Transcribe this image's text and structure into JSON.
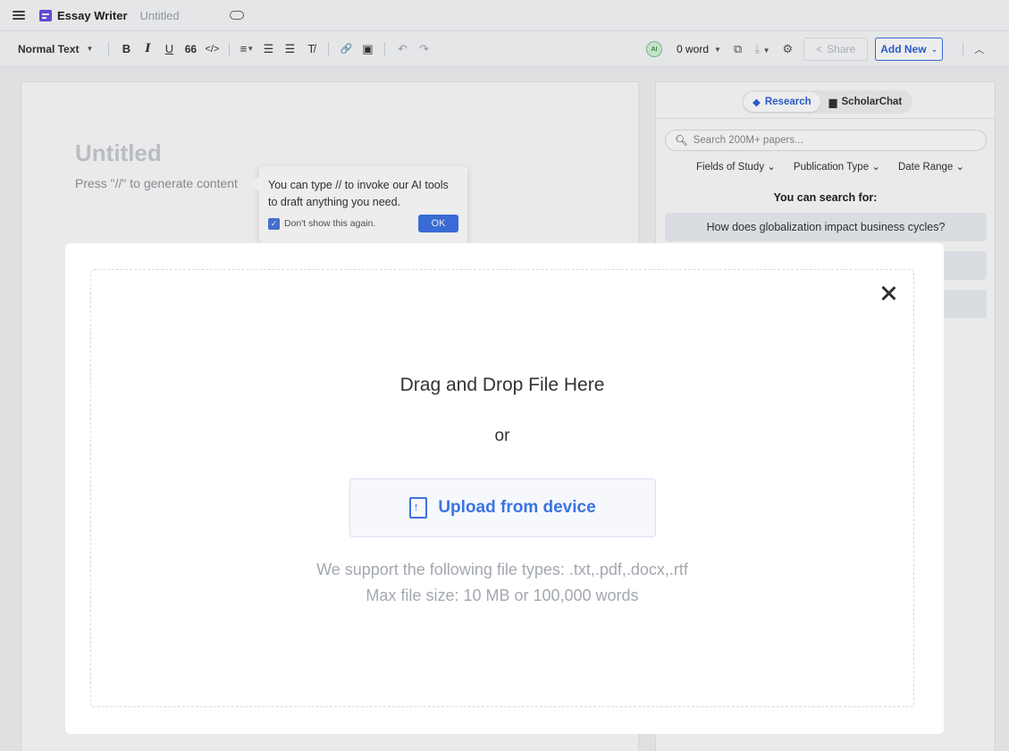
{
  "topbar": {
    "app_name": "Essay Writer",
    "doc_title": "Untitled"
  },
  "toolbar": {
    "text_style": "Normal Text",
    "buttons": {
      "bold": "B",
      "italic": "I",
      "underline": "U",
      "quote": "66",
      "code": "</>",
      "align": "≡",
      "bullets": "☰",
      "numbered": "☰",
      "clear": "T̸",
      "link": "🔗",
      "image": "▣",
      "undo": "↶",
      "redo": "↷"
    },
    "ai_badge": "AI",
    "word_count": "0 word",
    "share": "Share",
    "add_new": "Add New"
  },
  "editor": {
    "title_placeholder": "Untitled",
    "hint": "Press \"//\" to generate content",
    "tip": {
      "text": "You can type // to invoke our AI tools to draft anything you need.",
      "checkbox_label": "Don't show this again.",
      "ok": "OK"
    }
  },
  "panel": {
    "tabs": [
      {
        "label": "Research"
      },
      {
        "label": "ScholarChat"
      }
    ],
    "search_placeholder": "Search 200M+ papers...",
    "filters": [
      "Fields of Study",
      "Publication Type",
      "Date Range"
    ],
    "can_search": "You can search for:",
    "suggestions": [
      "How does globalization impact business cycles?",
      "",
      ""
    ]
  },
  "modal": {
    "title": "Drag and Drop File Here",
    "or": "or",
    "upload": "Upload from device",
    "types": "We support the following file types: .txt,.pdf,.docx,.rtf",
    "max_size": "Max file size: 10 MB or 100,000 words"
  }
}
